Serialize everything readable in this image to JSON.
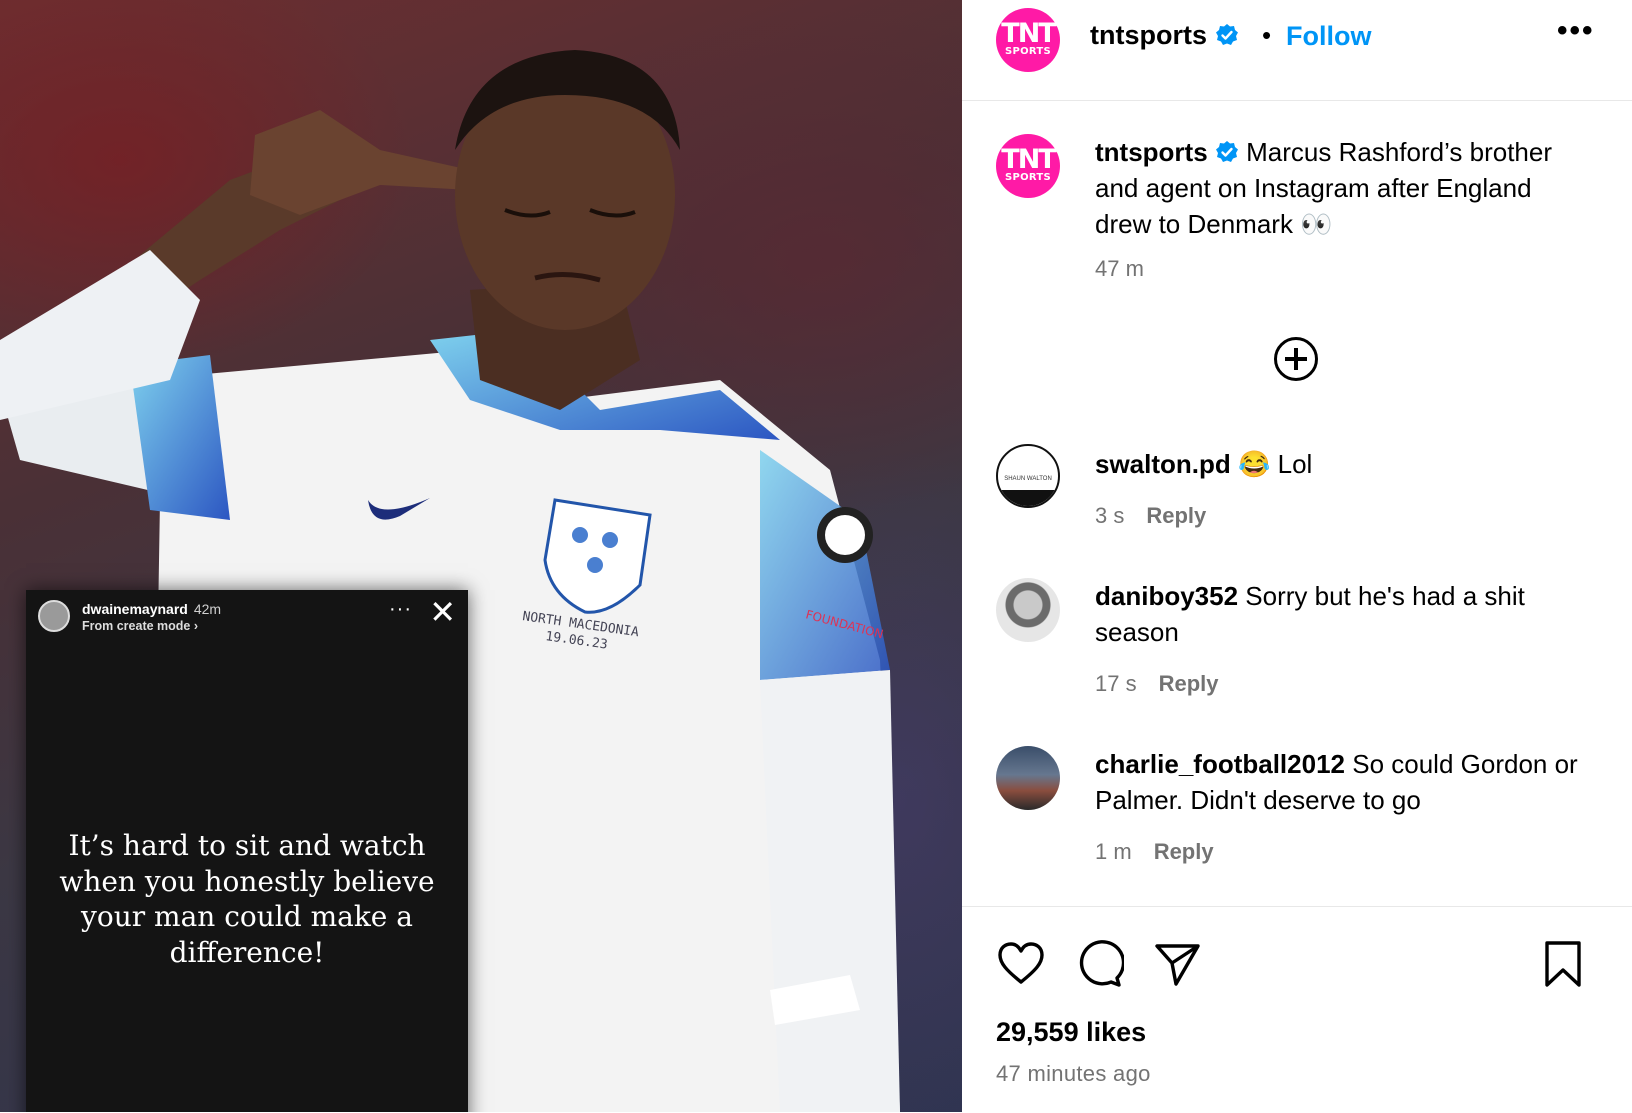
{
  "story_overlay": {
    "username": "dwainemaynard",
    "time": "42m",
    "mode": "From create mode ›",
    "more": "···",
    "close": "✕",
    "text": "It’s hard to sit and watch when you honestly believe your man could make a difference!"
  },
  "post": {
    "logo": {
      "line1": "TNT",
      "line2": "SPORTS"
    },
    "header": {
      "username": "tntsports",
      "separator": "•",
      "follow_label": "Follow",
      "more": "•••"
    },
    "caption": {
      "username": "tntsports",
      "text": "Marcus Rashford’s brother and agent on Instagram after England drew to Denmark 👀",
      "time": "47 m"
    },
    "comments": [
      {
        "username": "swalton.pd",
        "text": "😂 Lol",
        "time": "3 s",
        "reply": "Reply",
        "avatar_label": "SHAUN WALTON"
      },
      {
        "username": "daniboy352",
        "text": "Sorry but he's had a shit season",
        "time": "17 s",
        "reply": "Reply"
      },
      {
        "username": "charlie_football2012",
        "text": "So could Gordon or Palmer. Didn't deserve to go",
        "time": "1 m",
        "reply": "Reply"
      }
    ],
    "likes": "29,559 likes",
    "posted_ago": "47 minutes ago",
    "action_icons": [
      "heart-icon",
      "comment-icon",
      "share-icon",
      "bookmark-icon"
    ]
  },
  "colors": {
    "brand_pink": "#ff1aa6",
    "follow_blue": "#0095f6",
    "verified_blue": "#0095f6",
    "muted_text": "#737373"
  }
}
